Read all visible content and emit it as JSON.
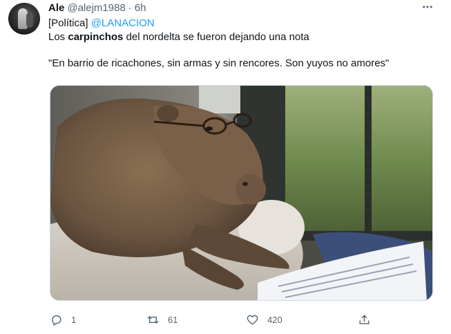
{
  "tweet": {
    "author_name": "Ale",
    "author_handle": "@alejm1988",
    "separator": "·",
    "time": "6h",
    "text_prefix": "[Política] ",
    "mention": "@LANACION",
    "line2_pre": "Los ",
    "line2_bold": "carpinchos",
    "line2_post": " del nordelta se fueron dejando una nota",
    "line3": "\"En barrio de ricachones, sin armas y sin rencores. Son yuyos no amores\""
  },
  "stats": {
    "replies": "1",
    "retweets": "61",
    "likes": "420"
  },
  "icons": {
    "more": "more-options-icon",
    "reply": "reply-icon",
    "retweet": "retweet-icon",
    "like": "like-icon",
    "share": "share-icon"
  },
  "colors": {
    "link": "#1d9bf0",
    "secondary_text": "#536471",
    "primary_text": "#0f1419"
  }
}
